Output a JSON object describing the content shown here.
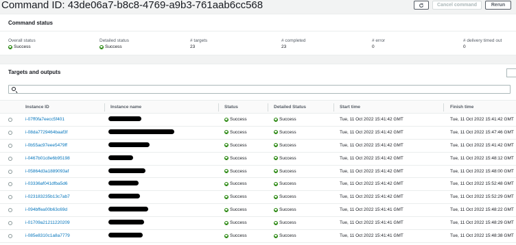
{
  "header": {
    "title": "Command ID: 43de06a7-b8c8-4769-a9b3-761aab6cc568",
    "refresh_icon": "refresh-icon",
    "cancel_label": "Cancel command",
    "rerun_label": "Rerun"
  },
  "status_panel": {
    "title": "Command status",
    "metrics": [
      {
        "label": "Overall status",
        "value": "Success",
        "icon": "success-icon"
      },
      {
        "label": "Detailed status",
        "value": "Success",
        "icon": "success-icon"
      },
      {
        "label": "# targets",
        "value": "23"
      },
      {
        "label": "# completed",
        "value": "23"
      },
      {
        "label": "# error",
        "value": "0"
      },
      {
        "label": "# delivery timed out",
        "value": "0"
      }
    ]
  },
  "targets_panel": {
    "title": "Targets and outputs",
    "search": {
      "value": "",
      "placeholder": ""
    },
    "columns": [
      "Instance ID",
      "Instance name",
      "Status",
      "Detailed Status",
      "Start time",
      "Finish time"
    ],
    "rows": [
      {
        "id": "i-07ff0fa7eecc5f401",
        "name": "",
        "status": "Success",
        "detailed": "Success",
        "start": "Tue, 11 Oct 2022 15:41:42 GMT",
        "finish": "Tue, 11 Oct 2022 15:41:42 GMT"
      },
      {
        "id": "i-08da7729464baaf3f",
        "name": "",
        "status": "Success",
        "detailed": "Success",
        "start": "Tue, 11 Oct 2022 15:41:42 GMT",
        "finish": "Tue, 11 Oct 2022 15:47:46 GMT"
      },
      {
        "id": "i-0b55ac97eee5479ff",
        "name": "",
        "status": "Success",
        "detailed": "Success",
        "start": "Tue, 11 Oct 2022 15:41:42 GMT",
        "finish": "Tue, 11 Oct 2022 15:41:42 GMT"
      },
      {
        "id": "i-0467b01c8e6b95198",
        "name": "",
        "status": "Success",
        "detailed": "Success",
        "start": "Tue, 11 Oct 2022 15:41:42 GMT",
        "finish": "Tue, 11 Oct 2022 15:48:12 GMT"
      },
      {
        "id": "i-05864d3a1889093af",
        "name": "",
        "status": "Success",
        "detailed": "Success",
        "start": "Tue, 11 Oct 2022 15:41:42 GMT",
        "finish": "Tue, 11 Oct 2022 15:48:00 GMT"
      },
      {
        "id": "i-03336af041dfba5d6",
        "name": "",
        "status": "Success",
        "detailed": "Success",
        "start": "Tue, 11 Oct 2022 15:41:42 GMT",
        "finish": "Tue, 11 Oct 2022 15:52:48 GMT"
      },
      {
        "id": "i-023183235b13c7ab7",
        "name": "",
        "status": "Success",
        "detailed": "Success",
        "start": "Tue, 11 Oct 2022 15:41:42 GMT",
        "finish": "Tue, 11 Oct 2022 15:52:29 GMT"
      },
      {
        "id": "i-094bffea00b63c69d",
        "name": "",
        "status": "Success",
        "detailed": "Success",
        "start": "Tue, 11 Oct 2022 15:41:41 GMT",
        "finish": "Tue, 11 Oct 2022 15:48:22 GMT"
      },
      {
        "id": "i-01709a21211220209",
        "name": "",
        "status": "Success",
        "detailed": "Success",
        "start": "Tue, 11 Oct 2022 15:41:41 GMT",
        "finish": "Tue, 11 Oct 2022 15:48:29 GMT"
      },
      {
        "id": "i-085e8310c1a8a7779",
        "name": "",
        "status": "Success",
        "detailed": "Success",
        "start": "Tue, 11 Oct 2022 15:41:41 GMT",
        "finish": "Tue, 11 Oct 2022 15:48:38 GMT"
      }
    ]
  },
  "colors": {
    "success": "#1d8102",
    "link": "#0073bb"
  }
}
